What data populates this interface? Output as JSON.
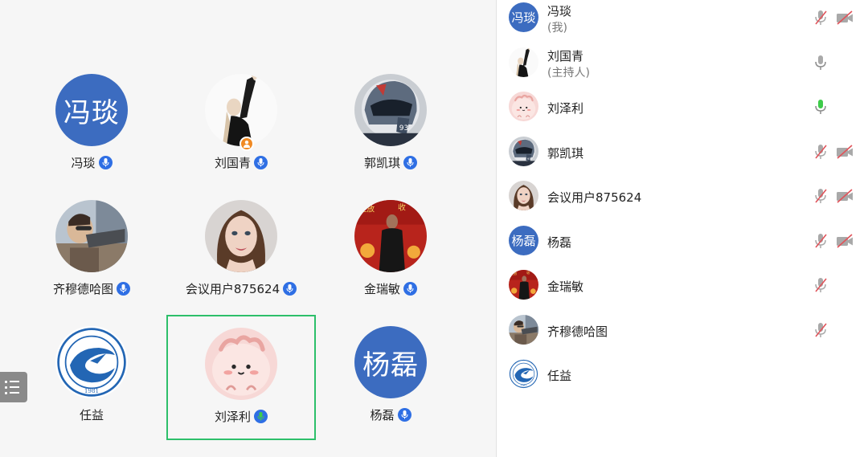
{
  "grid": {
    "tiles": [
      {
        "name": "冯琰",
        "avatar": "text",
        "avatar_text": "冯琰",
        "avatar_color": "#3c6cc0",
        "mic": "on"
      },
      {
        "name": "刘国青",
        "avatar": "photo-raised-arm",
        "mic": "on",
        "host": true
      },
      {
        "name": "郭凯琪",
        "avatar": "photo-helmet",
        "mic": "on"
      },
      {
        "name": "齐穆德哈图",
        "avatar": "photo-shooting",
        "mic": "on"
      },
      {
        "name": "会议用户875624",
        "avatar": "photo-woman",
        "mic": "on"
      },
      {
        "name": "金瑞敏",
        "avatar": "photo-stage",
        "mic": "on"
      },
      {
        "name": "任益",
        "avatar": "school-emblem",
        "emblem_year": "1981",
        "mic": "none"
      },
      {
        "name": "刘泽利",
        "avatar": "cartoon-pink",
        "mic": "speaking",
        "active": true
      },
      {
        "name": "杨磊",
        "avatar": "text",
        "avatar_text": "杨磊",
        "avatar_color": "#3c6cc0",
        "mic": "on"
      }
    ],
    "list_toggle_icon": "list-icon"
  },
  "participants": [
    {
      "name": "冯琰",
      "role": "(我)",
      "avatar": "text",
      "avatar_text": "冯琰",
      "mic": "muted",
      "cam": "off"
    },
    {
      "name": "刘国青",
      "role": "(主持人)",
      "avatar": "photo-raised-arm",
      "mic": "on",
      "cam": "none"
    },
    {
      "name": "刘泽利",
      "role": "",
      "avatar": "cartoon-pink",
      "mic": "speaking",
      "cam": "none"
    },
    {
      "name": "郭凯琪",
      "role": "",
      "avatar": "photo-helmet",
      "mic": "muted",
      "cam": "off"
    },
    {
      "name": "会议用户875624",
      "role": "",
      "avatar": "photo-woman",
      "mic": "muted",
      "cam": "off"
    },
    {
      "name": "杨磊",
      "role": "",
      "avatar": "text",
      "avatar_text": "杨磊",
      "mic": "muted",
      "cam": "off"
    },
    {
      "name": "金瑞敏",
      "role": "",
      "avatar": "photo-stage",
      "mic": "muted",
      "cam": "none"
    },
    {
      "name": "齐穆德哈图",
      "role": "",
      "avatar": "photo-shooting",
      "mic": "muted",
      "cam": "none"
    },
    {
      "name": "任益",
      "role": "",
      "avatar": "school-emblem",
      "emblem_year": "1981",
      "mic": "none",
      "cam": "none"
    }
  ],
  "colors": {
    "accent_blue": "#2f6fe4",
    "speaking_green": "#3ecb4a",
    "active_border": "#2dbf6a",
    "muted_red": "#e0535a",
    "host_orange": "#f08a24"
  }
}
